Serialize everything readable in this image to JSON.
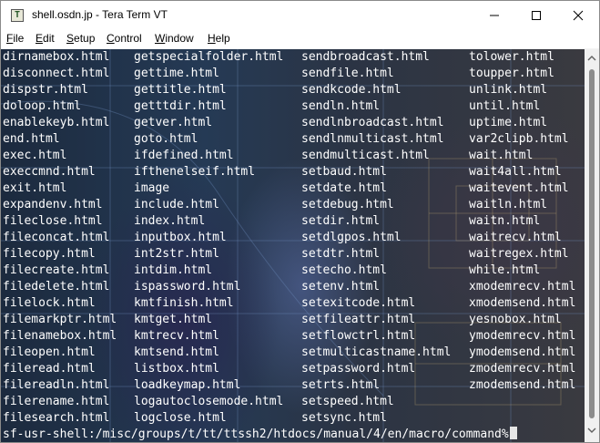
{
  "window": {
    "title": "shell.osdn.jp - Tera Term VT",
    "icon_letter": "T"
  },
  "menu": [
    {
      "pre": "",
      "u": "F",
      "post": "ile"
    },
    {
      "pre": "",
      "u": "E",
      "post": "dit"
    },
    {
      "pre": "",
      "u": "S",
      "post": "etup"
    },
    {
      "pre": "",
      "u": "C",
      "post": "ontrol"
    },
    {
      "pre": "",
      "u": "W",
      "post": "indow"
    },
    {
      "pre": "",
      "u": "H",
      "post": "elp"
    }
  ],
  "terminal": {
    "rows": [
      [
        "dirnamebox.html",
        "getspecialfolder.html",
        "sendbroadcast.html",
        "tolower.html"
      ],
      [
        "disconnect.html",
        "gettime.html",
        "sendfile.html",
        "toupper.html"
      ],
      [
        "dispstr.html",
        "gettitle.html",
        "sendkcode.html",
        "unlink.html"
      ],
      [
        "doloop.html",
        "getttdir.html",
        "sendln.html",
        "until.html"
      ],
      [
        "enablekeyb.html",
        "getver.html",
        "sendlnbroadcast.html",
        "uptime.html"
      ],
      [
        "end.html",
        "goto.html",
        "sendlnmulticast.html",
        "var2clipb.html"
      ],
      [
        "exec.html",
        "ifdefined.html",
        "sendmulticast.html",
        "wait.html"
      ],
      [
        "execcmnd.html",
        "ifthenelseif.html",
        "setbaud.html",
        "wait4all.html"
      ],
      [
        "exit.html",
        "image",
        "setdate.html",
        "waitevent.html"
      ],
      [
        "expandenv.html",
        "include.html",
        "setdebug.html",
        "waitln.html"
      ],
      [
        "fileclose.html",
        "index.html",
        "setdir.html",
        "waitn.html"
      ],
      [
        "fileconcat.html",
        "inputbox.html",
        "setdlgpos.html",
        "waitrecv.html"
      ],
      [
        "filecopy.html",
        "int2str.html",
        "setdtr.html",
        "waitregex.html"
      ],
      [
        "filecreate.html",
        "intdim.html",
        "setecho.html",
        "while.html"
      ],
      [
        "filedelete.html",
        "ispassword.html",
        "setenv.html",
        "xmodemrecv.html"
      ],
      [
        "filelock.html",
        "kmtfinish.html",
        "setexitcode.html",
        "xmodemsend.html"
      ],
      [
        "filemarkptr.html",
        "kmtget.html",
        "setfileattr.html",
        "yesnobox.html"
      ],
      [
        "filenamebox.html",
        "kmtrecv.html",
        "setflowctrl.html",
        "ymodemrecv.html"
      ],
      [
        "fileopen.html",
        "kmtsend.html",
        "setmulticastname.html",
        "ymodemsend.html"
      ],
      [
        "fileread.html",
        "listbox.html",
        "setpassword.html",
        "zmodemrecv.html"
      ],
      [
        "filereadln.html",
        "loadkeymap.html",
        "setrts.html",
        "zmodemsend.html"
      ],
      [
        "filerename.html",
        "logautoclosemode.html",
        "setspeed.html",
        ""
      ],
      [
        "filesearch.html",
        "logclose.html",
        "setsync.html",
        ""
      ]
    ],
    "prompt": "sf-usr-shell:/misc/groups/t/tt/ttssh2/htdocs/manual/4/en/macro/command%"
  },
  "colors": {
    "terminal_text": "#ffffff",
    "titlebar_bg": "#ffffff"
  },
  "icons": [
    "minimize-icon",
    "maximize-icon",
    "close-icon",
    "scroll-up-icon",
    "scroll-down-icon"
  ]
}
